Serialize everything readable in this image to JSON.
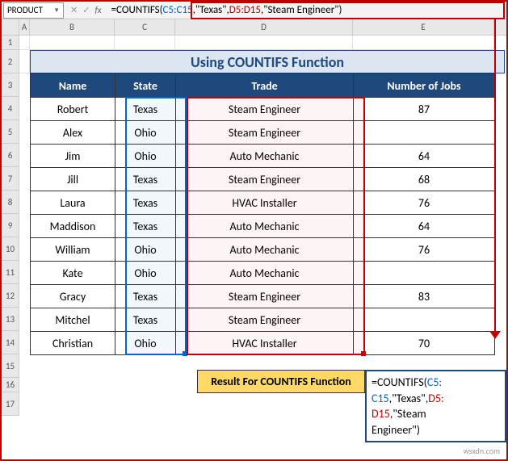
{
  "nameBox": "PRODUCT",
  "fxLabel": "fx",
  "formulaParts": {
    "eq": "=",
    "fn": "COUNTIFS",
    "open": "(",
    "ref1": "C5:C15",
    "c1": ",",
    "str1": "\"Texas\"",
    "c2": ",",
    "ref2": "D5:D15",
    "c3": ",",
    "str2": "\"Steam Engineer\"",
    "close": ")"
  },
  "cols": {
    "A": "A",
    "B": "B",
    "C": "C",
    "D": "D",
    "E": "E"
  },
  "rows": [
    "1",
    "2",
    "3",
    "4",
    "5",
    "6",
    "7",
    "8",
    "9",
    "10",
    "11",
    "12",
    "13",
    "14",
    "15",
    "16",
    "17"
  ],
  "title": "Using COUNTIFS Function",
  "headers": {
    "name": "Name",
    "state": "State",
    "trade": "Trade",
    "jobs": "Number of Jobs"
  },
  "data": [
    {
      "name": "Robert",
      "state": "Texas",
      "trade": "Steam Engineer",
      "jobs": "87"
    },
    {
      "name": "Alex",
      "state": "Ohio",
      "trade": "Steam Engineer",
      "jobs": ""
    },
    {
      "name": "Jim",
      "state": "Ohio",
      "trade": "Auto Mechanic",
      "jobs": "64"
    },
    {
      "name": "Jill",
      "state": "Texas",
      "trade": "Steam Engineer",
      "jobs": "68"
    },
    {
      "name": "Laura",
      "state": "Texas",
      "trade": "HVAC Installer",
      "jobs": "76"
    },
    {
      "name": "Maddison",
      "state": "Texas",
      "trade": "Auto Mechanic",
      "jobs": "64"
    },
    {
      "name": "William",
      "state": "Ohio",
      "trade": "Auto Mechanic",
      "jobs": "76"
    },
    {
      "name": "Kate",
      "state": "Ohio",
      "trade": "Auto Mechanic",
      "jobs": ""
    },
    {
      "name": "Gracy",
      "state": "Texas",
      "trade": "Steam Engineer",
      "jobs": "83"
    },
    {
      "name": "Mitchel",
      "state": "Texas",
      "trade": "Steam Engineer",
      "jobs": ""
    },
    {
      "name": "Christian",
      "state": "Ohio",
      "trade": "HVAC Installer",
      "jobs": "70"
    }
  ],
  "resultLabel": "Result For COUNTIFS Function",
  "cellFormula": {
    "p1a": "=COUNTIFS(",
    "p1b": "C5:",
    "p2a": "C15",
    "p2b": ",\"Texas\",",
    "p2c": "D5:",
    "p3a": "D15",
    "p3b": ",\"Steam",
    "p4": "Engineer\")"
  },
  "watermark": "wsxdn.com"
}
